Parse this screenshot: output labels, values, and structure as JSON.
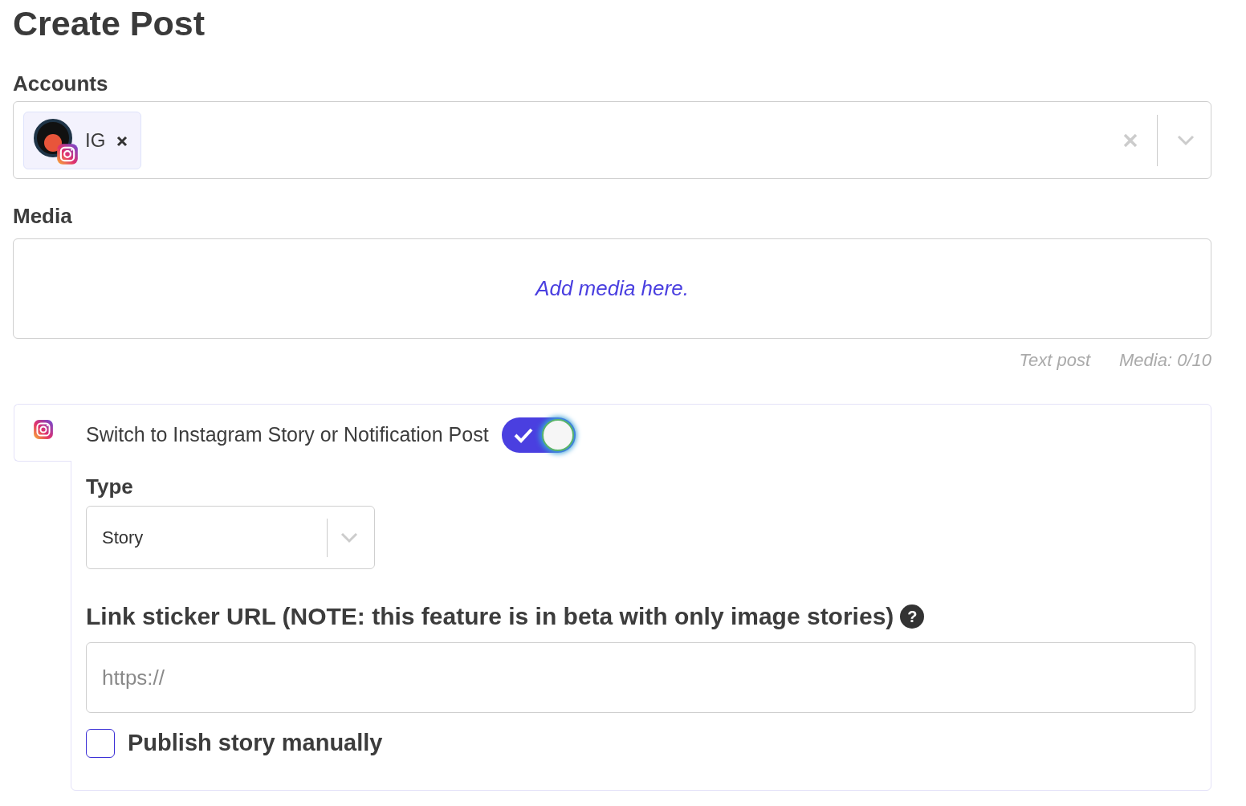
{
  "title": "Create Post",
  "accounts": {
    "label": "Accounts",
    "chips": [
      {
        "label": "IG"
      }
    ]
  },
  "media": {
    "label": "Media",
    "placeholder": "Add media here."
  },
  "footer": [
    "Text post",
    "Media: 0/10"
  ],
  "story_panel": {
    "toggle_label": "Switch to Instagram Story or Notification Post",
    "on": true,
    "type": {
      "label": "Type",
      "value": "Story"
    },
    "link": {
      "label": "Link sticker URL (NOTE: this feature is in beta with only image stories)",
      "help": "?",
      "placeholder": "https://"
    },
    "publish_manually": {
      "label": "Publish story manually",
      "checked": false
    }
  }
}
